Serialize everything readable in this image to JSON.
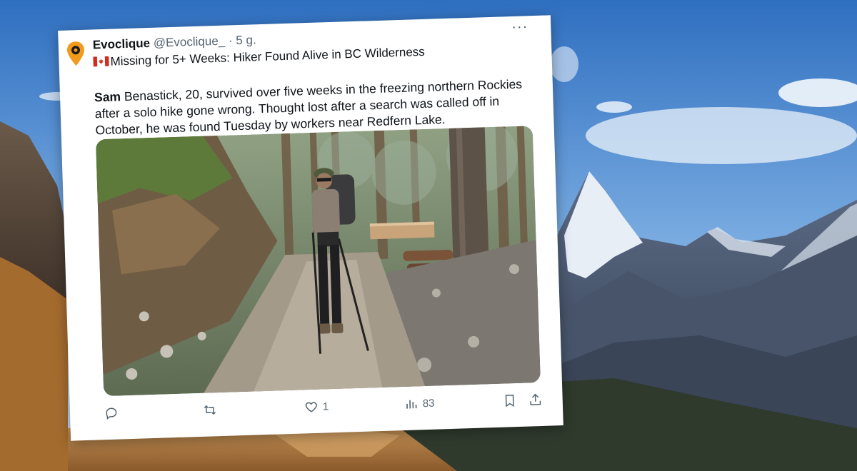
{
  "tweet": {
    "author_name": "Evoclique",
    "author_handle": "@Evoclique_",
    "separator": "·",
    "time": "5 g.",
    "more_label": "···",
    "flag_icon": "canada-flag-icon",
    "headline": "Missing for 5+ Weeks: Hiker Found Alive in BC Wilderness",
    "body_lead": "Sam",
    "body_rest": " Benastick, 20, survived over five weeks in the freezing northern Rockies after a solo hike gone wrong. Thought lost after a search was called off in October, he was found Tuesday by workers near Redfern Lake.",
    "photo_description_icon": "hiker-photo",
    "actions": {
      "reply_icon": "reply-icon",
      "retweet_icon": "retweet-icon",
      "like_icon": "heart-icon",
      "like_count": "1",
      "views_icon": "views-chart-icon",
      "views_count": "83",
      "bookmark_icon": "bookmark-icon",
      "share_icon": "share-icon"
    }
  },
  "colors": {
    "sky": "#3f7fc8",
    "text_primary": "#0f1419",
    "text_secondary": "#536471",
    "avatar_orange": "#f39a1c"
  }
}
